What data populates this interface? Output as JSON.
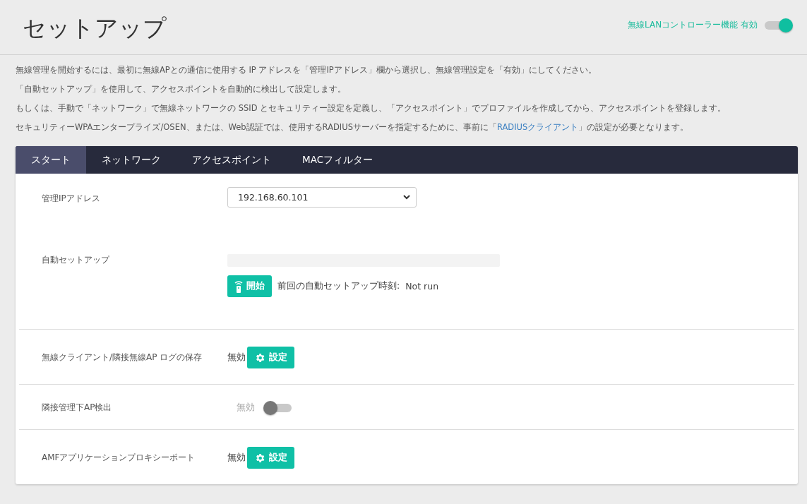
{
  "header": {
    "title": "セットアップ",
    "controller": {
      "label": "無線LANコントローラー機能 有効",
      "on": true
    }
  },
  "intro": [
    {
      "text": "無線管理を開始するには、最初に無線APとの通信に使用する IP アドレスを「管理IPアドレス」欄から選択し、無線管理設定を「有効」にしてください。"
    },
    {
      "text": "「自動セットアップ」を使用して、アクセスポイントを自動的に検出して設定します。"
    },
    {
      "text": "もしくは、手動で「ネットワーク」で無線ネットワークの SSID とセキュリティー設定を定義し、「アクセスポイント」でプロファイルを作成してから、アクセスポイントを登録します。"
    },
    {
      "text": "セキュリティーWPAエンタープライズ/OSEN、または、Web認証では、使用するRADIUSサーバーを指定するために、事前に「",
      "link": "RADIUSクライアント",
      "after": "」の設定が必要となります。"
    }
  ],
  "tabs": [
    {
      "label": "スタート",
      "selected": true
    },
    {
      "label": "ネットワーク",
      "selected": false
    },
    {
      "label": "アクセスポイント",
      "selected": false
    },
    {
      "label": "MACフィルター",
      "selected": false
    }
  ],
  "rows": [
    {
      "kind": "select",
      "label": "管理IPアドレス",
      "value": "192.168.60.101"
    },
    {
      "kind": "autosetup",
      "label": "自動セットアップ",
      "level": 0,
      "button": "開始",
      "last_run_label": "前回の自動セットアップ時刻:",
      "last_run": "Not run"
    },
    {
      "kind": "button",
      "label": "無線クライアント/隣接無線AP ログの保存",
      "status": "無効",
      "button": "設定"
    },
    {
      "kind": "toggle",
      "label": "隣接管理下AP検出",
      "status": "無効",
      "on": false
    },
    {
      "kind": "button",
      "label": "AMFアプリケーションプロキシーポート",
      "status": "無効",
      "button": "設定"
    }
  ]
}
